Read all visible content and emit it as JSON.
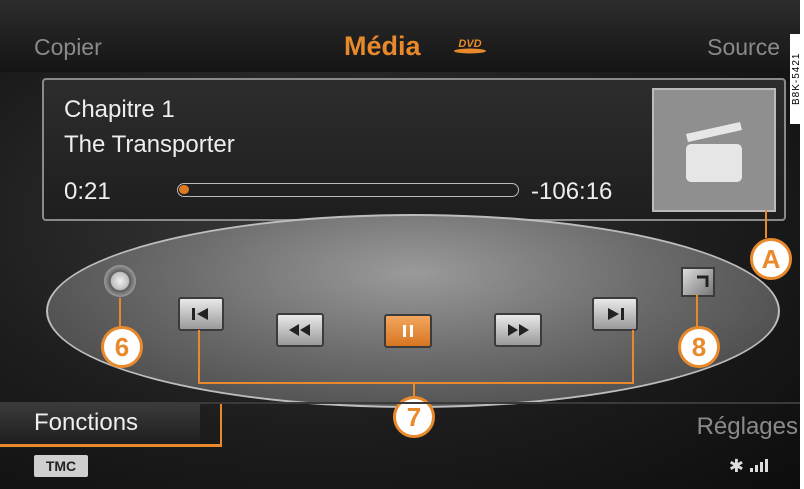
{
  "header": {
    "left_tab": "Copier",
    "title": "Média",
    "title_badge": "DVD",
    "right_tab": "Source"
  },
  "side_code": "B8K-5421",
  "now_playing": {
    "chapter": "Chapitre 1",
    "title": "The Transporter",
    "elapsed": "0:21",
    "remaining": "-106:16",
    "progress_fraction": 0.01
  },
  "controls": {
    "buttons": [
      "previous",
      "rewind",
      "pause",
      "fast-forward",
      "next"
    ],
    "active": "pause"
  },
  "callouts": {
    "a": "A",
    "six": "6",
    "seven": "7",
    "eight": "8"
  },
  "footer": {
    "left_tab": "Fonctions",
    "right_tab": "Réglages",
    "tmc": "TMC"
  },
  "colors": {
    "accent": "#e88a2c",
    "text": "#eeeeee",
    "muted": "#8a8a8a"
  }
}
